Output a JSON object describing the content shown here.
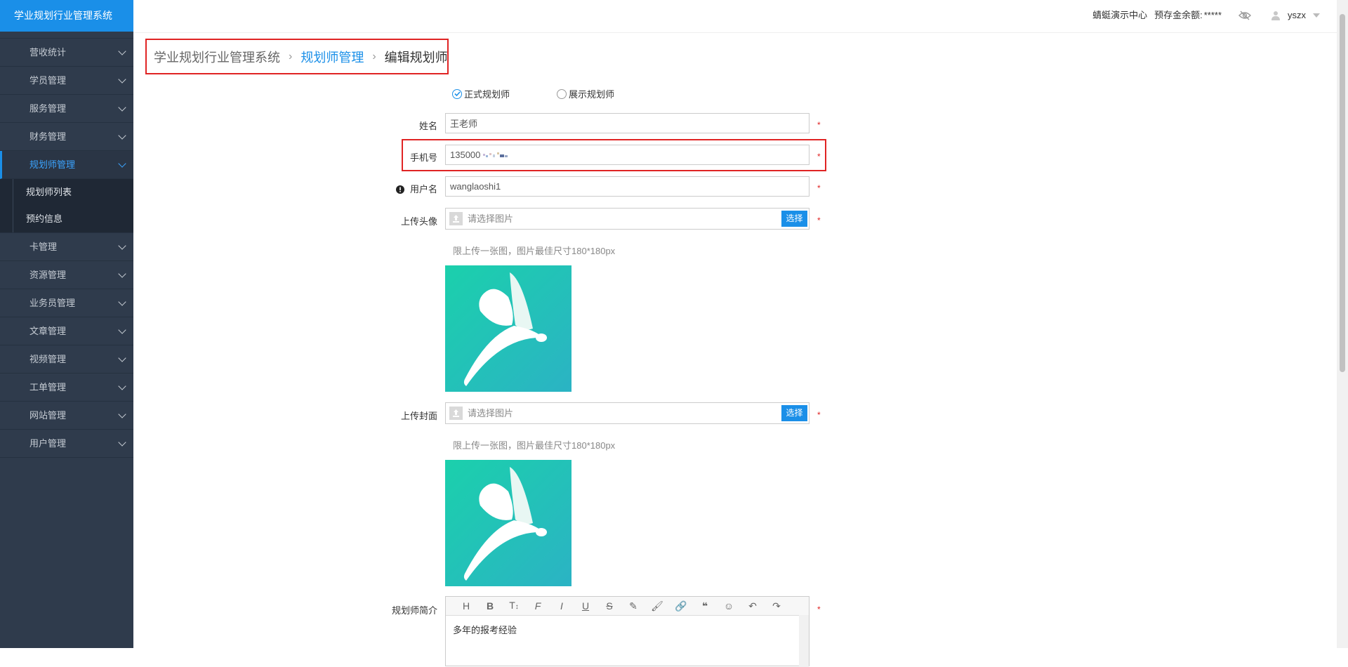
{
  "app": {
    "title": "学业规划行业管理系统"
  },
  "sidebar": {
    "items": [
      {
        "label": "营收统计"
      },
      {
        "label": "学员管理"
      },
      {
        "label": "服务管理"
      },
      {
        "label": "财务管理"
      },
      {
        "label": "规划师管理",
        "active": true
      },
      {
        "label": "卡管理"
      },
      {
        "label": "资源管理"
      },
      {
        "label": "业务员管理"
      },
      {
        "label": "文章管理"
      },
      {
        "label": "视频管理"
      },
      {
        "label": "工单管理"
      },
      {
        "label": "网站管理"
      },
      {
        "label": "用户管理"
      }
    ],
    "subitems": [
      {
        "label": "规划师列表"
      },
      {
        "label": "预约信息"
      }
    ]
  },
  "topbar": {
    "center_link": "蜻蜓演示中心",
    "balance_label": "预存金余额:",
    "balance_value": "*****",
    "username": "yszx"
  },
  "breadcrumb": {
    "root": "学业规划行业管理系统",
    "section": "规划师管理",
    "current": "编辑规划师"
  },
  "form": {
    "type_options": [
      {
        "label": "正式规划师",
        "checked": true
      },
      {
        "label": "展示规划师",
        "checked": false
      }
    ],
    "name_label": "姓名",
    "name_value": "王老师",
    "phone_label": "手机号",
    "phone_value": "135000",
    "username_label": "用户名",
    "username_value": "wanglaoshi1",
    "avatar_label": "上传头像",
    "avatar_placeholder": "请选择图片",
    "avatar_button": "选择",
    "avatar_hint": "限上传一张图，图片最佳尺寸180*180px",
    "cover_label": "上传封面",
    "cover_placeholder": "请选择图片",
    "cover_button": "选择",
    "cover_hint": "限上传一张图，图片最佳尺寸180*180px",
    "intro_label": "规划师简介",
    "intro_text": "多年的报考经验",
    "required_mark": "*"
  },
  "colors": {
    "brand_blue": "#1a8fe8",
    "sidebar_bg": "#2f3b4c",
    "highlight_red": "#e02424",
    "logo_teal": "#20c6b0"
  }
}
